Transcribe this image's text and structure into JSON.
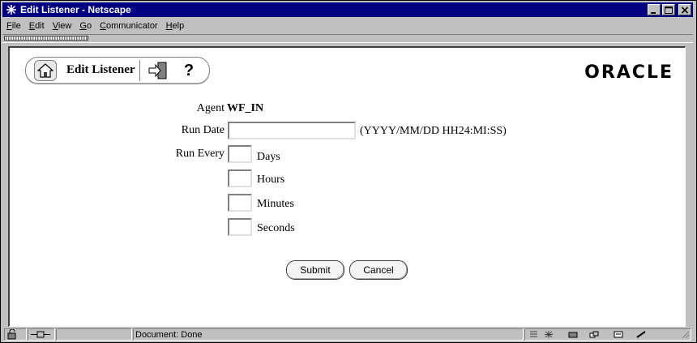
{
  "window": {
    "title": "Edit Listener - Netscape",
    "controls": [
      "minimize",
      "maximize",
      "close"
    ]
  },
  "menubar": {
    "items": [
      {
        "label": "File",
        "accel": "F"
      },
      {
        "label": "Edit",
        "accel": "E"
      },
      {
        "label": "View",
        "accel": "V"
      },
      {
        "label": "Go",
        "accel": "G"
      },
      {
        "label": "Communicator",
        "accel": "C"
      },
      {
        "label": "Help",
        "accel": "H"
      }
    ]
  },
  "page_toolbar": {
    "title": "Edit Listener",
    "help_symbol": "?",
    "icons": [
      "home-icon",
      "exit-icon",
      "help-icon"
    ]
  },
  "brand": {
    "logo_text": "ORACLE"
  },
  "form": {
    "agent_label": "Agent",
    "agent_value": "WF_IN",
    "run_date_label": "Run Date",
    "run_date_value": "",
    "run_date_hint": "(YYYY/MM/DD HH24:MI:SS)",
    "run_every_label": "Run Every",
    "units": {
      "days": "Days",
      "hours": "Hours",
      "minutes": "Minutes",
      "seconds": "Seconds"
    },
    "days_value": "",
    "hours_value": "",
    "minutes_value": "",
    "seconds_value": ""
  },
  "buttons": {
    "submit": "Submit",
    "cancel": "Cancel"
  },
  "statusbar": {
    "text": "Document: Done"
  }
}
